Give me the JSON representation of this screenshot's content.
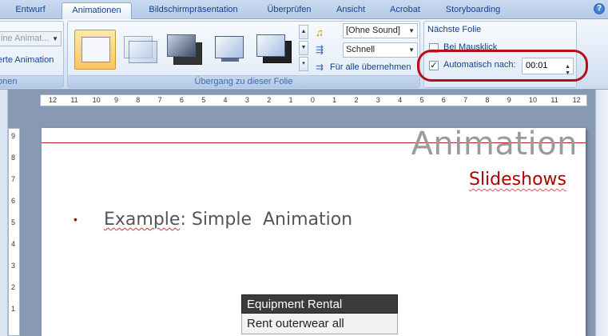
{
  "tabs": [
    "Entwurf",
    "Animationen",
    "Bildschirmpräsentation",
    "Überprüfen",
    "Ansicht",
    "Acrobat",
    "Storyboarding"
  ],
  "help_icon": "help-icon",
  "ribbon": {
    "left_group": {
      "combo_value": "ine Animat...",
      "button_label": "erte Animation",
      "group_label": "onen"
    },
    "transition_group": {
      "sound_value": "[Ohne Sound]",
      "speed_value": "Schnell",
      "apply_all_label": "Für alle übernehmen",
      "group_label": "Übergang zu dieser Folie"
    },
    "next_slide": {
      "heading": "Nächste Folie",
      "on_click_label": "Bei Mausklick",
      "on_click_checked": false,
      "auto_label": "Automatisch nach:",
      "auto_checked": true,
      "auto_value": "00:01"
    }
  },
  "ruler": {
    "h_labels": [
      "12",
      "11",
      "10",
      "9",
      "8",
      "7",
      "6",
      "5",
      "4",
      "3",
      "2",
      "1",
      "0",
      "1",
      "2",
      "3",
      "4",
      "5",
      "6",
      "7",
      "8",
      "9",
      "10",
      "11",
      "12"
    ],
    "v_labels": [
      "9",
      "8",
      "7",
      "6",
      "5",
      "4",
      "3",
      "2",
      "1"
    ]
  },
  "slide": {
    "title": "Animation",
    "subtitle": "Slideshows",
    "bullet_word1": "Example",
    "bullet_rest": ": Simple  Animation",
    "table_header": "Equipment Rental",
    "table_row1": "Rent outerwear all"
  },
  "colors": {
    "accent_red": "#b00000",
    "highlight_ring": "#b50f17",
    "tab_text": "#15428b"
  }
}
